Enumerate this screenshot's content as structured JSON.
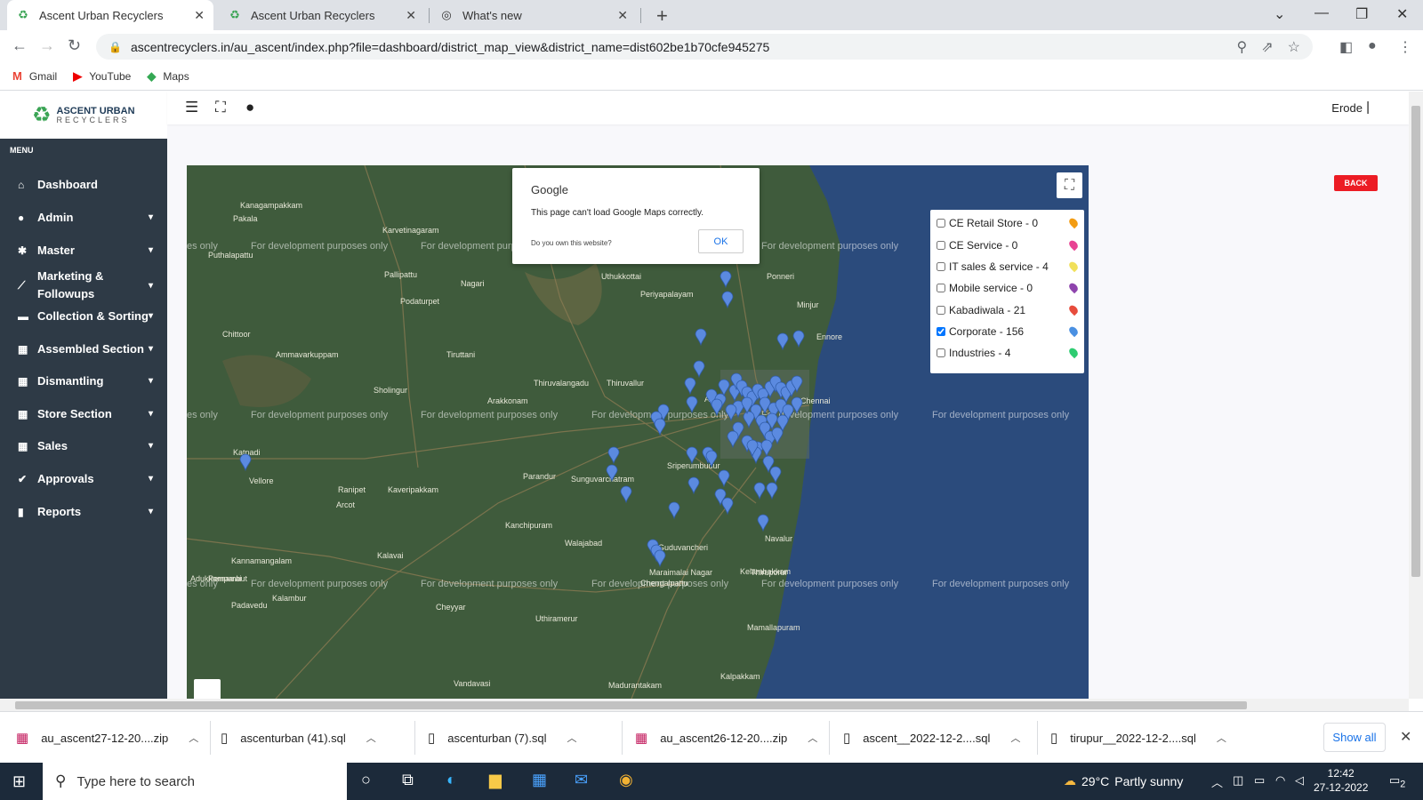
{
  "browser": {
    "tabs": [
      {
        "label": "Ascent Urban Recyclers",
        "active": true
      },
      {
        "label": "Ascent Urban Recyclers",
        "active": false
      },
      {
        "label": "What's new",
        "active": false
      }
    ],
    "url": "ascentrecyclers.in/au_ascent/index.php?file=dashboard/district_map_view&district_name=dist602be1b70cfe945275",
    "bookmarks": [
      "Gmail",
      "YouTube",
      "Maps"
    ]
  },
  "app": {
    "logo_line1": "ASCENT URBAN",
    "logo_line2": "RECYCLERS",
    "menu_label": "MENU",
    "sidebar": [
      {
        "label": "Dashboard",
        "icon": "home-icon",
        "glyph": "⌂",
        "chevron": false
      },
      {
        "label": "Admin",
        "icon": "user-icon",
        "glyph": "●",
        "chevron": true
      },
      {
        "label": "Master",
        "icon": "gear-icon",
        "glyph": "✱",
        "chevron": true
      },
      {
        "label": "Marketing & Followups",
        "icon": "link-icon",
        "glyph": "⟋",
        "chevron": true
      },
      {
        "label": "Collection & Sorting",
        "icon": "cart-icon",
        "glyph": "▬",
        "chevron": true
      },
      {
        "label": "Assembled Section",
        "icon": "table-icon",
        "glyph": "▦",
        "chevron": true
      },
      {
        "label": "Dismantling",
        "icon": "table-icon",
        "glyph": "▦",
        "chevron": true
      },
      {
        "label": "Store Section",
        "icon": "table-icon",
        "glyph": "▦",
        "chevron": true
      },
      {
        "label": "Sales",
        "icon": "table-icon",
        "glyph": "▦",
        "chevron": true
      },
      {
        "label": "Approvals",
        "icon": "check-circle-icon",
        "glyph": "✔",
        "chevron": true
      },
      {
        "label": "Reports",
        "icon": "file-icon",
        "glyph": "▮",
        "chevron": true
      }
    ],
    "topbar_location": "Erode",
    "topbar_sep": "|",
    "back_label": "BACK"
  },
  "map": {
    "watermark": "For development purposes only",
    "watermark_short": "es only",
    "dialog": {
      "title": "Google",
      "message": "This page can't load Google Maps correctly.",
      "owner_question": "Do you own this website?",
      "ok_label": "OK"
    },
    "legend": [
      {
        "label": "CE Retail Store - 0",
        "checked": false,
        "color": "#f39c12"
      },
      {
        "label": "CE Service - 0",
        "checked": false,
        "color": "#e84393"
      },
      {
        "label": "IT sales & service - 4",
        "checked": false,
        "color": "#f1e05a"
      },
      {
        "label": "Mobile service - 0",
        "checked": false,
        "color": "#8e44ad"
      },
      {
        "label": "Kabadiwala - 21",
        "checked": false,
        "color": "#e74c3c"
      },
      {
        "label": "Corporate - 156",
        "checked": true,
        "color": "#4a90e2"
      },
      {
        "label": "Industries - 4",
        "checked": false,
        "color": "#2ecc71"
      }
    ],
    "places": [
      "Kanagampakkam",
      "Pakala",
      "Karvetinagaram",
      "Nagari",
      "Ponneri",
      "Periyapalayam",
      "Uthukkottai",
      "Puthalapattu",
      "Pallipattu",
      "Podaturpet",
      "Minjur",
      "Ennore",
      "Avadi",
      "Chennai",
      "Tiruttani",
      "Thiruvalangadu",
      "Thiruvallur",
      "Chittoor",
      "Sholingur",
      "Arakkonam",
      "Vellore",
      "Katpadi",
      "Ranipet",
      "Arcot",
      "Kaveripakkam",
      "Sriperumbudur",
      "Sunguvarchatram",
      "Parandur",
      "Kanchipuram",
      "Walajabad",
      "Guduvancheri",
      "Maraimalai Nagar",
      "Kelambakkam",
      "Navalur",
      "Adukkamparai",
      "Kannamangalam",
      "Kalavai",
      "Chengalpattu",
      "Thiruporur",
      "Padavedu",
      "Kalambur",
      "Cheyyar",
      "Uthiramerur",
      "Mamallapuram",
      "Kalpakkam",
      "Madurantakam",
      "Vandavasi",
      "Ammavarkuppam",
      "Pernambut"
    ]
  },
  "downloads": {
    "items": [
      {
        "name": "au_ascent27-12-20....zip",
        "icon": "zip-icon"
      },
      {
        "name": "ascenturban (41).sql",
        "icon": "file-icon"
      },
      {
        "name": "ascenturban (7).sql",
        "icon": "file-icon"
      },
      {
        "name": "au_ascent26-12-20....zip",
        "icon": "zip-icon"
      },
      {
        "name": "ascent__2022-12-2....sql",
        "icon": "file-icon"
      },
      {
        "name": "tirupur__2022-12-2....sql",
        "icon": "file-icon"
      }
    ],
    "show_all": "Show all"
  },
  "taskbar": {
    "search_placeholder": "Type here to search",
    "temperature": "29°C",
    "weather": "Partly sunny",
    "time": "12:42",
    "date": "27-12-2022",
    "notifications": "2"
  }
}
